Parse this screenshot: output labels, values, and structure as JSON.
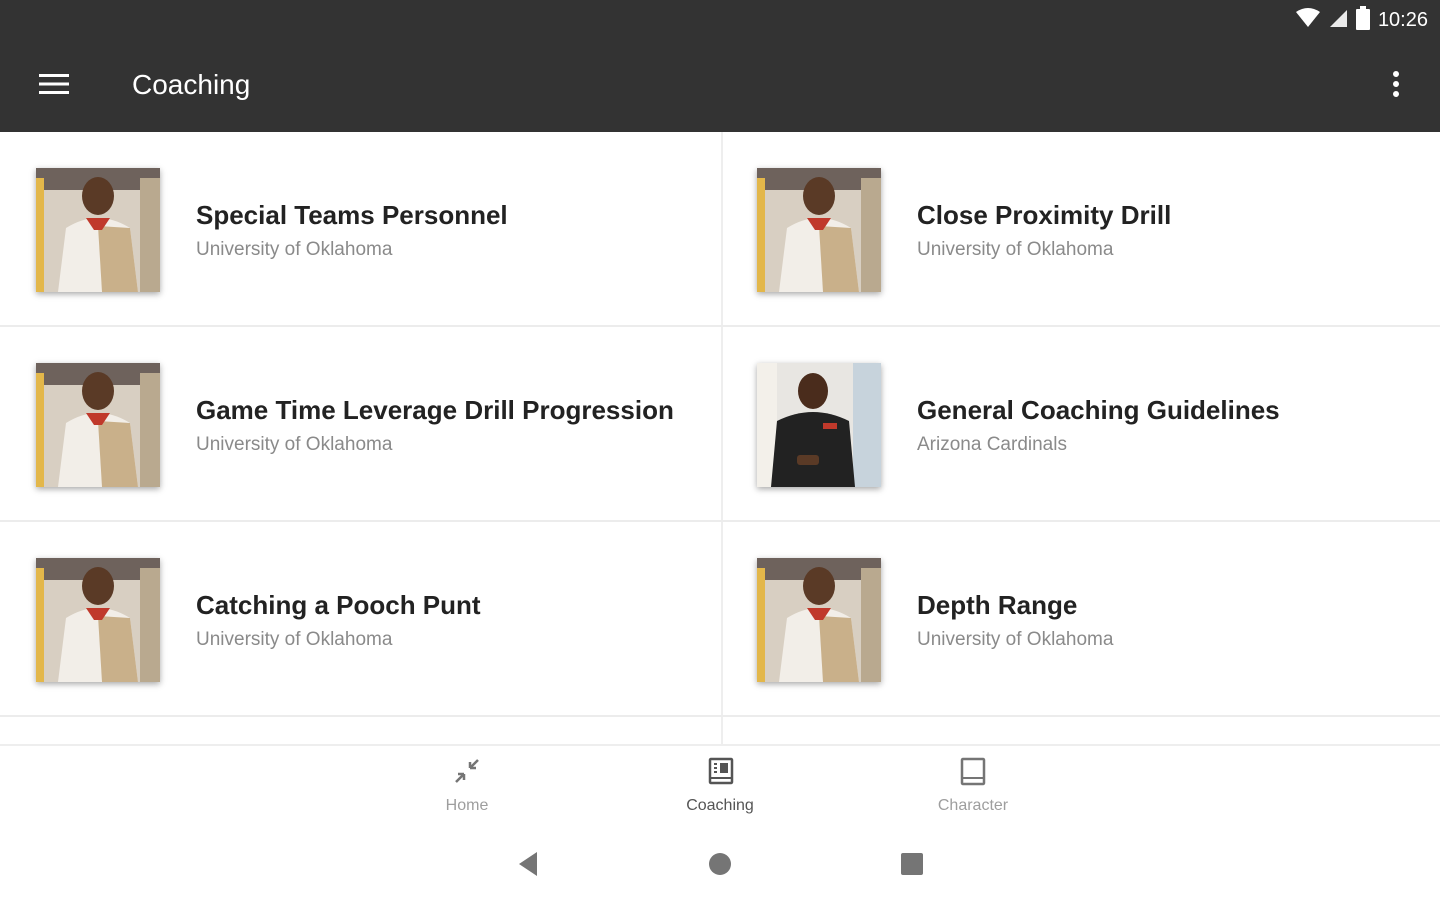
{
  "status_bar": {
    "time": "10:26"
  },
  "app_bar": {
    "title": "Coaching"
  },
  "items": [
    {
      "title": "Special Teams Personnel",
      "subtitle": "University of Oklahoma",
      "thumb": "coach-a"
    },
    {
      "title": "Close Proximity Drill",
      "subtitle": "University of Oklahoma",
      "thumb": "coach-a"
    },
    {
      "title": "Game Time Leverage Drill Progression",
      "subtitle": "University of Oklahoma",
      "thumb": "coach-a"
    },
    {
      "title": "General Coaching Guidelines",
      "subtitle": "Arizona Cardinals",
      "thumb": "coach-b"
    },
    {
      "title": "Catching a Pooch Punt",
      "subtitle": "University of Oklahoma",
      "thumb": "coach-a"
    },
    {
      "title": "Depth Range",
      "subtitle": "University of Oklahoma",
      "thumb": "coach-a"
    }
  ],
  "bottom_nav": {
    "items": [
      {
        "label": "Home",
        "icon": "compress-arrows-icon",
        "active": false
      },
      {
        "label": "Coaching",
        "icon": "book-icon",
        "active": true
      },
      {
        "label": "Character",
        "icon": "tablet-icon",
        "active": false
      }
    ]
  },
  "colors": {
    "app_bar": "#333333",
    "title_text": "#222222",
    "subtitle_text": "#8a8a8a",
    "divider": "#eeeeee"
  }
}
